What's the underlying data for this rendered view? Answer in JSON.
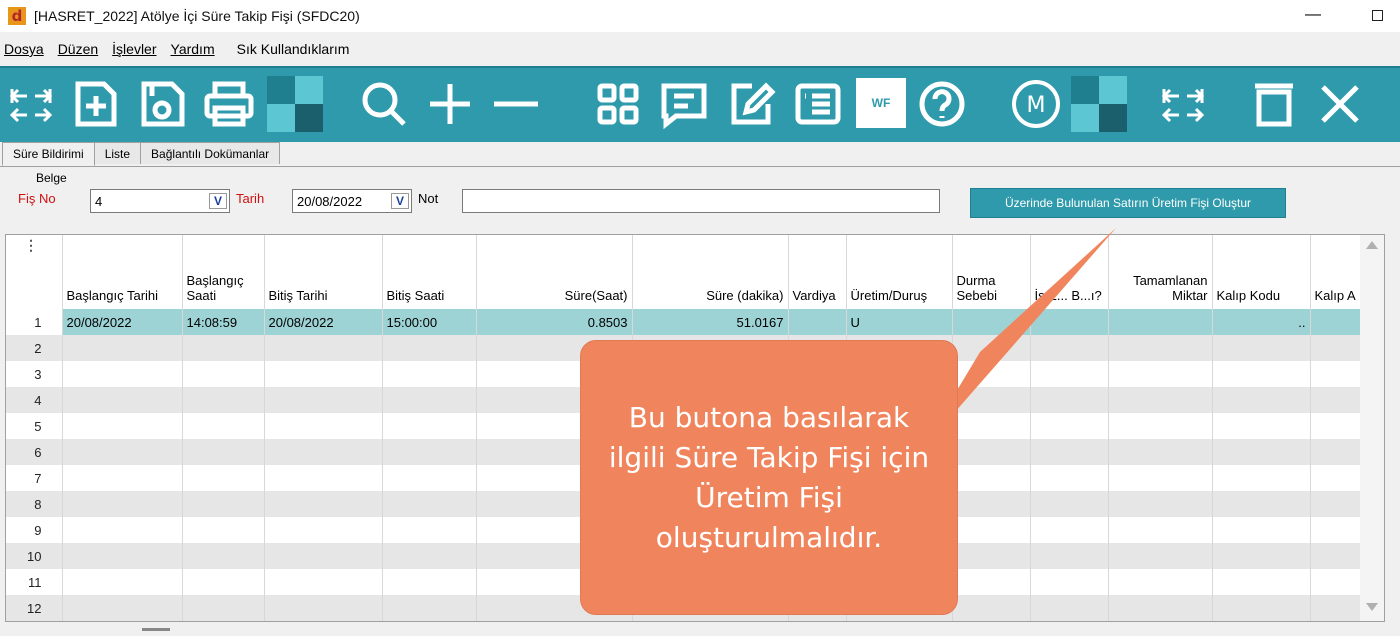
{
  "window": {
    "app_letter": "d",
    "title": "[HASRET_2022] Atölye İçi Süre Takip Fişi (SFDC20)",
    "min_label": "—"
  },
  "menu": [
    "Dosya",
    "Düzen",
    "İşlevler",
    "Yardım"
  ],
  "menu_extra": "Sık Kullandıklarım",
  "toolbar": {
    "wf_label": "WF",
    "m_label": "M",
    "icons": [
      "first-last-icon",
      "new-doc-icon",
      "save-icon",
      "print-icon",
      "color-square-icon",
      "search-icon",
      "add-icon",
      "remove-icon",
      "grid-view-icon",
      "comment-icon",
      "edit-icon",
      "list-icon",
      "wf-icon",
      "help-icon",
      "m-icon",
      "color-square-icon",
      "first-last-icon",
      "delete-icon",
      "close-icon"
    ]
  },
  "tabs": [
    "Süre Bildirimi",
    "Liste",
    "Bağlantılı Dokümanlar"
  ],
  "form": {
    "group_label": "Belge",
    "fis_no_label": "Fiş No",
    "fis_no_value": "4",
    "tarih_label": "Tarih",
    "tarih_value": "20/08/2022",
    "not_label": "Not",
    "not_value": "",
    "drop_glyph": "V",
    "action_button": "Üzerinde Bulunulan Satırın Üretim Fişi Oluştur"
  },
  "grid": {
    "grip": "⋮",
    "columns": [
      "Başlangıç Tarihi",
      "Başlangıç Saati",
      "Bitiş Tarihi",
      "Bitiş Saati",
      "Süre(Saat)",
      "Süre (dakika)",
      "Vardiya",
      "Üretim/Duruş",
      "Durma Sebebi",
      "İş E... B...ı?",
      "Tamamlanan Miktar",
      "Kalıp Kodu",
      "Kalıp A"
    ],
    "rows": [
      {
        "n": "1",
        "bas_tarih": "20/08/2022",
        "bas_saat": "14:08:59",
        "bit_tarih": "20/08/2022",
        "bit_saat": "15:00:00",
        "sure_saat": "0.8503",
        "sure_dk": "51.0167",
        "vardiya": "",
        "uretim": "U",
        "kalip": ".."
      },
      {
        "n": "2"
      },
      {
        "n": "3"
      },
      {
        "n": "4"
      },
      {
        "n": "5"
      },
      {
        "n": "6"
      },
      {
        "n": "7"
      },
      {
        "n": "8"
      },
      {
        "n": "9"
      },
      {
        "n": "10"
      },
      {
        "n": "11"
      },
      {
        "n": "12"
      }
    ]
  },
  "callout": {
    "text": "Bu butona basılarak ilgili Süre Takip Fişi için Üretim Fişi oluşturulmalıdır.",
    "color": "#f0855d"
  },
  "colors": {
    "toolbar": "#2e9aab",
    "selected_row": "#9ed3d6",
    "required_label": "#d01010"
  }
}
